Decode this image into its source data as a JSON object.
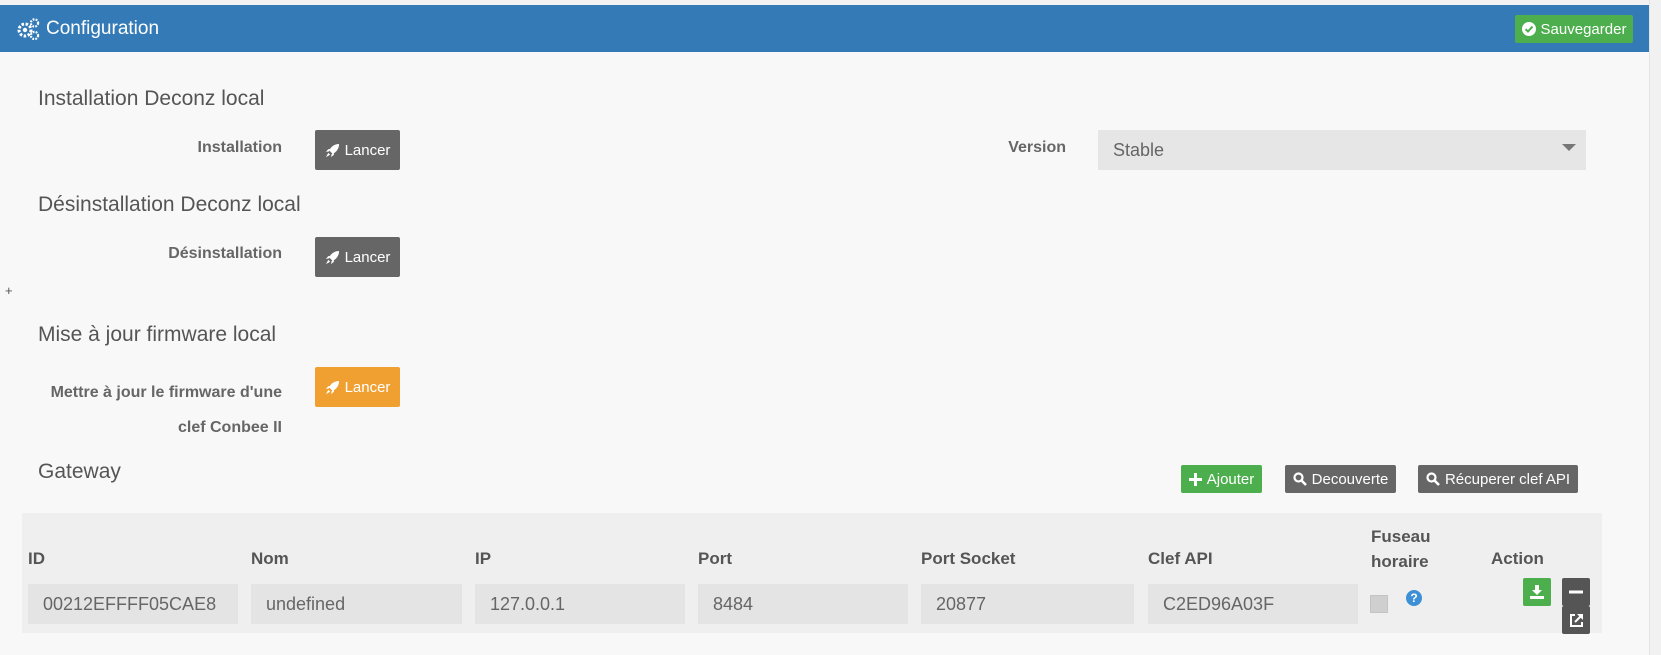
{
  "header": {
    "title": "Configuration",
    "save_label": "Sauvegarder"
  },
  "install": {
    "heading": "Installation Deconz local",
    "label": "Installation",
    "button": "Lancer",
    "version_label": "Version",
    "version_value": "Stable"
  },
  "uninstall": {
    "heading": "Désinstallation Deconz local",
    "label": "Désinstallation",
    "button": "Lancer"
  },
  "expander": "+",
  "firmware": {
    "heading": "Mise à jour firmware local",
    "label_line1": "Mettre à jour le firmware d'une",
    "label_line2": "clef Conbee II",
    "button": "Lancer"
  },
  "gateway": {
    "heading": "Gateway",
    "add_label": "Ajouter",
    "discover_label": "Decouverte",
    "fetch_key_label": "Récuperer clef API",
    "columns": {
      "id": "ID",
      "name": "Nom",
      "ip": "IP",
      "port": "Port",
      "socket": "Port Socket",
      "key": "Clef API",
      "tz1": "Fuseau",
      "tz2": "horaire",
      "action": "Action"
    },
    "row": {
      "id": "00212EFFFF05CAE8",
      "name": "undefined",
      "ip": "127.0.0.1",
      "port": "8484",
      "socket": "20877",
      "key": "C2ED96A03F",
      "help": "?"
    }
  },
  "colors": {
    "header": "#337ab7",
    "success": "#4cae4c",
    "warning": "#f0a030",
    "dark": "#666666"
  }
}
